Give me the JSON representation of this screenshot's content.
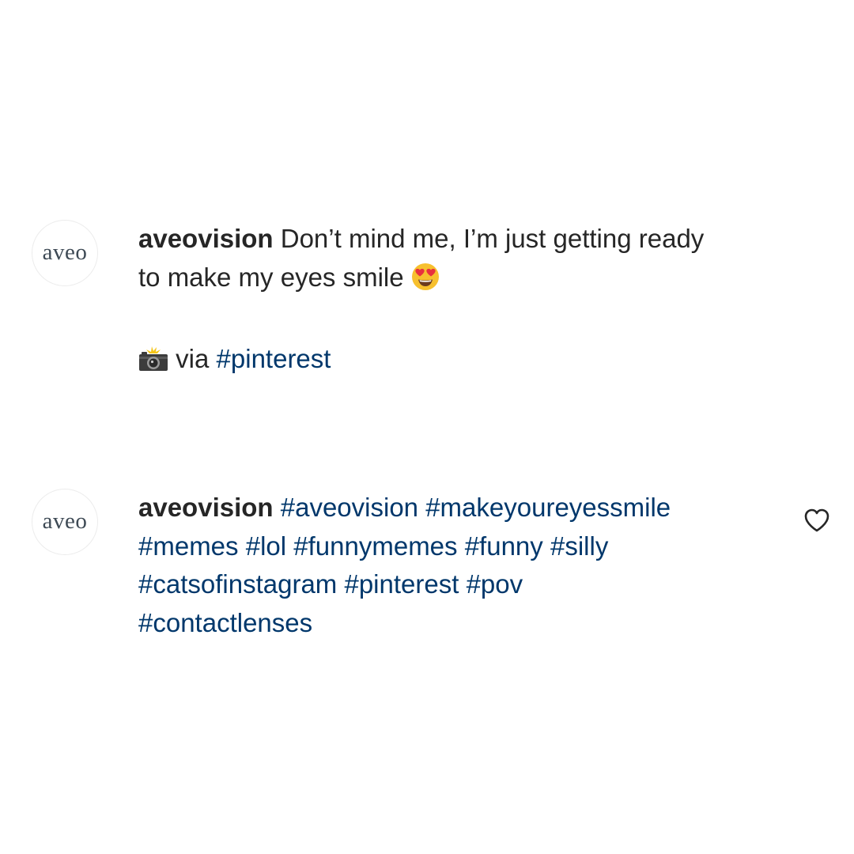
{
  "posts": [
    {
      "avatar_text": "aveo",
      "username": "aveovision",
      "line1": "Don’t mind me, I’m just getting ready",
      "line2": "to make my eyes smile",
      "emoji_icon": "heart-eyes-emoji",
      "camera_icon": "camera-flash-emoji",
      "via_text": "via",
      "hashtag": "#pinterest"
    },
    {
      "avatar_text": "aveo",
      "username": "aveovision",
      "hashtags": [
        "#aveovision",
        "#makeyoureyessmile",
        "#memes",
        "#lol",
        "#funnymemes",
        "#funny",
        "#silly",
        "#catsofinstagram",
        "#pinterest",
        "#pov",
        "#contactlenses"
      ],
      "like_icon": "heart-outline-icon"
    }
  ],
  "colors": {
    "text": "#262626",
    "hashtag": "#00376b",
    "avatar_text": "#3e4a55",
    "emoji_face": "#f7c02e",
    "emoji_heart": "#e8313e"
  }
}
